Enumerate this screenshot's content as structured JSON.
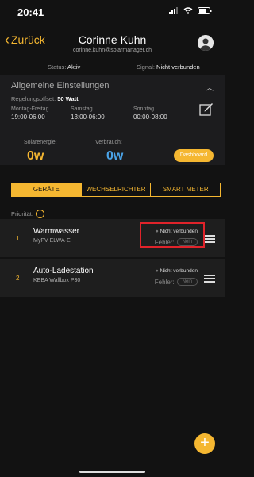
{
  "status_bar": {
    "time": "20:41"
  },
  "header": {
    "back_label": "Zurück",
    "user_name": "Corinne Kuhn",
    "user_email": "corinne.kuhn@solarmanager.ch"
  },
  "status": {
    "status_label": "Status:",
    "status_value": "Aktiv",
    "signal_label": "Signal:",
    "signal_value": "Nicht verbunden"
  },
  "settings": {
    "title": "Allgemeine Einstellungen",
    "reg_label": "Regelungsoffset:",
    "reg_value": "50 Watt",
    "schedule": [
      {
        "day": "Montag-Freitag",
        "time": "19:00-06:00"
      },
      {
        "day": "Samstag",
        "time": "13:00-06:00"
      },
      {
        "day": "Sonntag",
        "time": "00:00-08:00"
      }
    ],
    "solar_label": "Solarenergie:",
    "solar_value": "0w",
    "consumption_label": "Verbrauch:",
    "consumption_value": "0w",
    "dashboard_label": "Dashboard",
    "accent": "#f5b731"
  },
  "tabs": [
    {
      "label": "GERÄTE",
      "active": true
    },
    {
      "label": "WECHSELRICHTER",
      "active": false
    },
    {
      "label": "SMART METER",
      "active": false
    }
  ],
  "priority_label": "Priorität:",
  "devices": [
    {
      "num": "1",
      "name": "Warmwasser",
      "model": "MyPV ELWA-E",
      "status": "Nicht verbunden",
      "error_label": "Fehler:",
      "error_value": "Nein"
    },
    {
      "num": "2",
      "name": "Auto-Ladestation",
      "model": "KEBA Wallbox P30",
      "status": "Nicht verbunden",
      "error_label": "Fehler:",
      "error_value": "Nein"
    }
  ]
}
